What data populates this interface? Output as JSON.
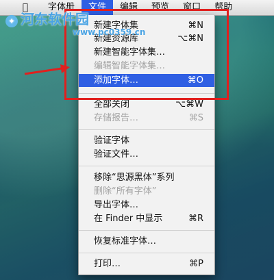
{
  "menubar": {
    "apple_icon": "apple-logo",
    "items": [
      "字体册",
      "文件",
      "编辑",
      "预览",
      "窗口",
      "帮助"
    ],
    "active_index": 1
  },
  "watermark": {
    "text": "河东软件园",
    "subtext": "www.pc0359.cn"
  },
  "file_menu": {
    "items": [
      {
        "label": "新建字体集",
        "shortcut": "⌘N",
        "enabled": true
      },
      {
        "label": "新建资源库",
        "shortcut": "⌥⌘N",
        "enabled": true
      },
      {
        "label": "新建智能字体集…",
        "shortcut": "",
        "enabled": true
      },
      {
        "label": "编辑智能字体集…",
        "shortcut": "",
        "enabled": false
      },
      {
        "label": "添加字体…",
        "shortcut": "⌘O",
        "enabled": true,
        "highlighted": true
      },
      {
        "label": "全部关闭",
        "shortcut": "⌥⌘W",
        "enabled": true
      },
      {
        "label": "存储报告…",
        "shortcut": "⌘S",
        "enabled": false
      },
      {
        "label": "验证字体",
        "shortcut": "",
        "enabled": true
      },
      {
        "label": "验证文件…",
        "shortcut": "",
        "enabled": true
      },
      {
        "label": "移除“思源黑体”系列",
        "shortcut": "",
        "enabled": true
      },
      {
        "label": "删除“所有字体”",
        "shortcut": "",
        "enabled": false
      },
      {
        "label": "导出字体…",
        "shortcut": "",
        "enabled": true
      },
      {
        "label": "在 Finder 中显示",
        "shortcut": "⌘R",
        "enabled": true
      },
      {
        "label": "恢复标准字体…",
        "shortcut": "",
        "enabled": true
      },
      {
        "label": "打印…",
        "shortcut": "⌘P",
        "enabled": true
      }
    ]
  },
  "colors": {
    "highlight": "#2f5fe3",
    "annotation": "#e0201e"
  }
}
